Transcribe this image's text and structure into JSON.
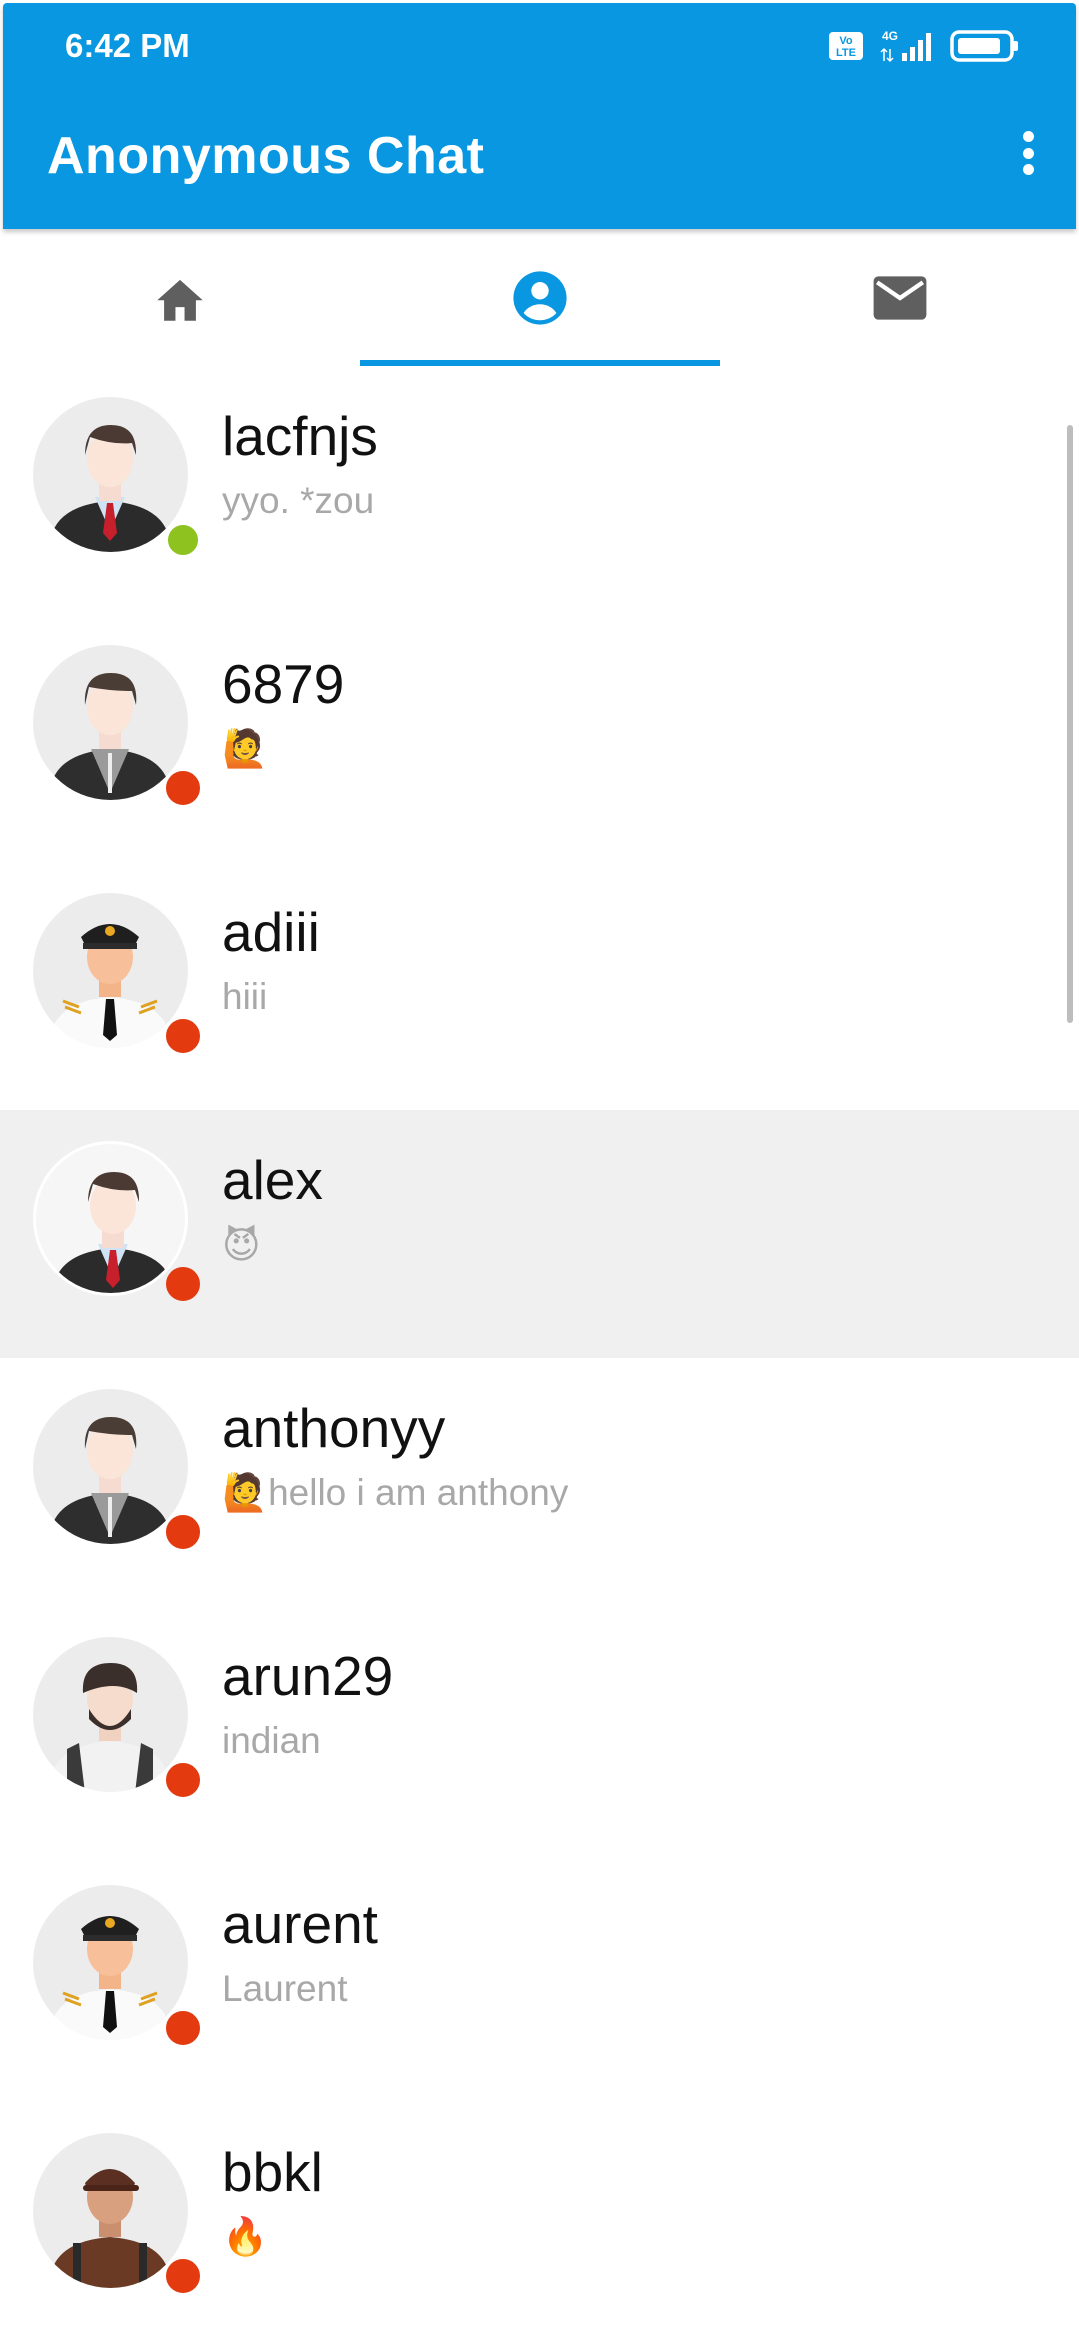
{
  "status_bar": {
    "time": "6:42 PM",
    "network": "4G",
    "volte": "Vo LTE"
  },
  "app": {
    "title": "Anonymous Chat"
  },
  "tabs": [
    {
      "icon": "home-icon",
      "selected": false
    },
    {
      "icon": "account-circle-icon",
      "selected": true
    },
    {
      "icon": "mail-icon",
      "selected": false
    }
  ],
  "colors": {
    "primary": "#0897e0",
    "online": "#8dc21f",
    "offline": "#e33b0f",
    "selected_row": "#f0f0f0"
  },
  "users": [
    {
      "name": "lacfnjs",
      "message": "yyo. *zou",
      "status": "online",
      "avatar": "businessman-avatar"
    },
    {
      "name": "6879",
      "message": "🙋",
      "status": "offline",
      "avatar": "vest-man-avatar"
    },
    {
      "name": "adiii",
      "message": "hiii",
      "status": "offline",
      "avatar": "pilot-avatar"
    },
    {
      "name": "alex",
      "message": "😈",
      "status": "offline",
      "avatar": "businessman-avatar"
    },
    {
      "name": "anthonyy",
      "message": "🙋hello i am anthony",
      "status": "offline",
      "avatar": "vest-man-avatar"
    },
    {
      "name": "arun29",
      "message": "indian",
      "status": "offline",
      "avatar": "bearded-man-avatar"
    },
    {
      "name": "aurent",
      "message": "Laurent",
      "status": "offline",
      "avatar": "pilot-avatar"
    },
    {
      "name": "bbkl",
      "message": "🔥",
      "status": "offline",
      "avatar": "cap-man-avatar"
    }
  ]
}
